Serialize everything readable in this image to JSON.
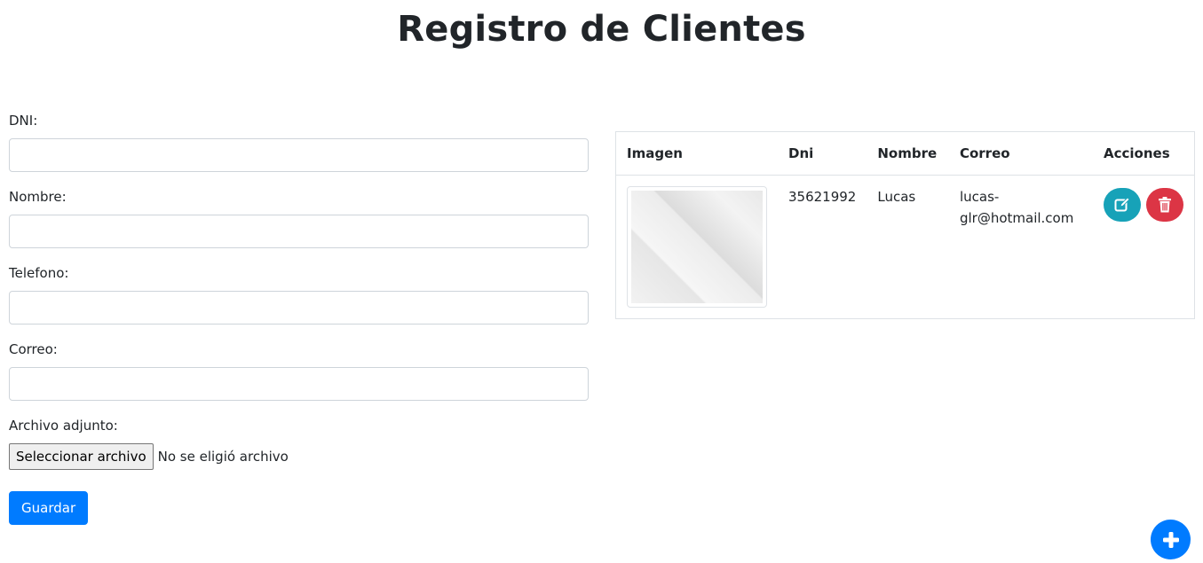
{
  "header": {
    "title": "Registro de Clientes"
  },
  "form": {
    "dni": {
      "label": "DNI:",
      "value": ""
    },
    "nombre": {
      "label": "Nombre:",
      "value": ""
    },
    "telefono": {
      "label": "Telefono:",
      "value": ""
    },
    "correo": {
      "label": "Correo:",
      "value": ""
    },
    "archivo": {
      "label": "Archivo adjunto:",
      "button_label": "Seleccionar archivo",
      "status": "No se eligió archivo"
    },
    "save_label": "Guardar"
  },
  "table": {
    "headers": [
      "Imagen",
      "Dni",
      "Nombre",
      "Correo",
      "Acciones"
    ],
    "rows": [
      {
        "image": "placeholder-image",
        "dni": "35621992",
        "nombre": "Lucas",
        "correo_line1": "lucas-",
        "correo_line2": "glr@hotmail.com",
        "actions": [
          "edit-icon",
          "trash-icon"
        ]
      }
    ]
  },
  "fab": {
    "icon": "plus-icon"
  },
  "colors": {
    "primary": "#007bff",
    "edit": "#17a2b8",
    "delete": "#dc3545",
    "border": "#dee2e6"
  }
}
